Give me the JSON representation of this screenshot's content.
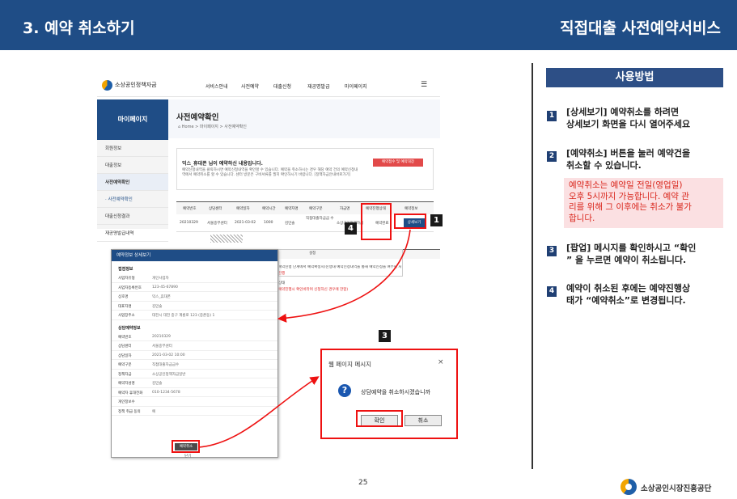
{
  "header": {
    "title": "3. 예약 취소하기",
    "service": "직접대출 사전예약서비스"
  },
  "site": {
    "logo_text": "소상공인정책자금",
    "menu": [
      "서비스안내",
      "사전예약",
      "대출신청",
      "재공명발급",
      "마이페이지"
    ]
  },
  "sidebar": {
    "head": "마이페이지",
    "items": [
      "회원정보",
      "대출정보",
      "사전예약확인",
      "· 사전예약확인",
      "대출신청결과",
      "재공명발급내역"
    ]
  },
  "content": {
    "title": "사전예약확인",
    "breadcrumb": "⌂ Home > 마이페이지 > 사전예약확인",
    "notice_title": "익스_휴대폰 님이 예약하신 내용입니다.",
    "notice_body": "예약신청내역을 클릭하시면 예약신청내역을 확인할 수 있습니다. 예약을 취소하시는 경우 해당 예약 건의 예약신청내역에서 예약취소를 할 수 있습니다. 센터 방문은 구비서류를 필히 확인하시기 바랍니다. [정책자금안내바로가기]",
    "red_button": "예약접수 및 예약대장",
    "table_headers": [
      "예약번호",
      "상담센터",
      "예약일자",
      "예약시간",
      "예약자명",
      "예약구분",
      "자금명",
      "예약진행상태",
      "예약정보"
    ],
    "table_row": [
      "20210329",
      "서울중부센터",
      "2021-03-02",
      "1000",
      "김민술",
      "직접대출자금금 수",
      "소상공인정책자금",
      "예약완료",
      "상세보기"
    ]
  },
  "popup": {
    "title": "예약정보 상세보기",
    "section1": "접점정보",
    "rows1": [
      {
        "k": "사업자유형",
        "v": "개인사업자"
      },
      {
        "k": "사업자등록번호",
        "v": "123-45-67890"
      },
      {
        "k": "상호명",
        "v": "익스_휴대폰"
      },
      {
        "k": "대표자명",
        "v": "김민술"
      },
      {
        "k": "사업장주소",
        "v": "대전시 대전 중구 계룡로 123 (중촌동) 1"
      }
    ],
    "section2": "상담예약정보",
    "rows2": [
      {
        "k": "예약번호",
        "v": "20210329"
      },
      {
        "k": "상담센터",
        "v": "서울중부센터"
      },
      {
        "k": "상담일자",
        "v": "2021-03-02 10:00"
      },
      {
        "k": "예약구분",
        "v": "직접대출자금금수"
      },
      {
        "k": "정책자금",
        "v": "소상공인정책자금일반"
      },
      {
        "k": "예약자성명",
        "v": "김민술"
      },
      {
        "k": "예약자 휴대전화",
        "v": "010-1234-5678"
      },
      {
        "k": "개인정보수",
        "v": ""
      },
      {
        "k": "정책 취급 동의",
        "v": "예"
      }
    ],
    "cancel_button": "예약취소",
    "close_button": "닫기"
  },
  "overlay_text": {
    "col": "설정",
    "line1": "예약진행 단계에서 예약확정시(진행대 예약신청내역을 통해 예약신청을 여부를 사전안 정)",
    "line2": "진행",
    "line3": "상태",
    "line4": "예약진행시 확인바라며 신청하신 경우에 한함)"
  },
  "dialog": {
    "title": "웹 페이지 메시지",
    "close": "×",
    "icon": "?",
    "message": "상담예약을 취소하시겠습니까",
    "ok": "확인",
    "cancel": "취소"
  },
  "markers": [
    "1",
    "4",
    "3"
  ],
  "guide": {
    "header": "사용방법",
    "steps": [
      {
        "n": "1",
        "text": "[상세보기] 예약취소를 하려면\n상세보기 화면을 다시 열어주세요"
      },
      {
        "n": "2",
        "text": "[예약취소] 버튼을 눌러 예약건을\n취소할 수 있습니다."
      },
      {
        "n": "3",
        "text": "[팝업] 메시지를 확인하시고 “확인\n” 을 누르면 예약이 취소됩니다."
      },
      {
        "n": "4",
        "text": "예약이 취소된 후에는 예약진행상\n태가 “예약취소”로 변경됩니다."
      }
    ],
    "note": "예약취소는 예약일 전일(영업일)\n오후 5시까지 가능합니다. 예약 관\n리를 위해 그 이후에는 취소가 불가\n합니다."
  },
  "footer": {
    "page": "25",
    "org": "소상공인시장진흥공단"
  },
  "colors": {
    "brand": "#1f4d86",
    "highlight": "#e11111",
    "note_bg": "#fbe0e2",
    "note_text": "#d9261c"
  }
}
